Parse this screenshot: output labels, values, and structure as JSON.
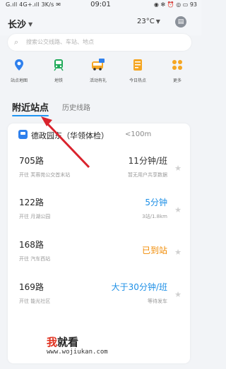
{
  "status_bar": {
    "left": "G.ıll 4G+.ıll 3K/s ✉",
    "time": "09:01",
    "right": "◉ ✻ ⏰ ◎ ▭ 93"
  },
  "header": {
    "city": "长沙",
    "weather": "23°C",
    "message_icon": "chat-bubble-icon"
  },
  "search": {
    "placeholder": "搜索公交线路、车站、地点"
  },
  "quick_access": [
    {
      "label": "站点地图",
      "icon": "stop-map-icon",
      "color": "#2f80ed"
    },
    {
      "label": "地铁",
      "icon": "subway-icon",
      "color": "#1faa59"
    },
    {
      "label": "活动有礼",
      "icon": "gift-bus-icon",
      "color": "#f5a623"
    },
    {
      "label": "今日热点",
      "icon": "hot-news-icon",
      "color": "#f5a623"
    },
    {
      "label": "更多",
      "icon": "more-grid-icon",
      "color": "#f5a623"
    }
  ],
  "tabs": {
    "active": "附近站点",
    "inactive": "历史线路"
  },
  "stop": {
    "name": "德政园东（华领体检）",
    "distance": "<100m"
  },
  "routes": [
    {
      "name": "705路",
      "dest": "开往  芙蓉苑公交首末站",
      "eta": "11分钟/班",
      "eta_color": "dark",
      "sub": "暂无用户共享数据"
    },
    {
      "name": "122路",
      "dest": "开往  月湖公园",
      "eta": "5分钟",
      "eta_color": "blue",
      "sub": "3站/1.8km"
    },
    {
      "name": "168路",
      "dest": "开往  汽车西站",
      "eta": "已到站",
      "eta_color": "orange",
      "sub": ""
    },
    {
      "name": "169路",
      "dest": "开往  能光社区",
      "eta": "大于30分钟/班",
      "eta_color": "blue",
      "sub": "等待发车"
    }
  ],
  "watermark": {
    "logo_a": "我",
    "logo_b": "就看",
    "url": "www.wojiukan.com"
  }
}
